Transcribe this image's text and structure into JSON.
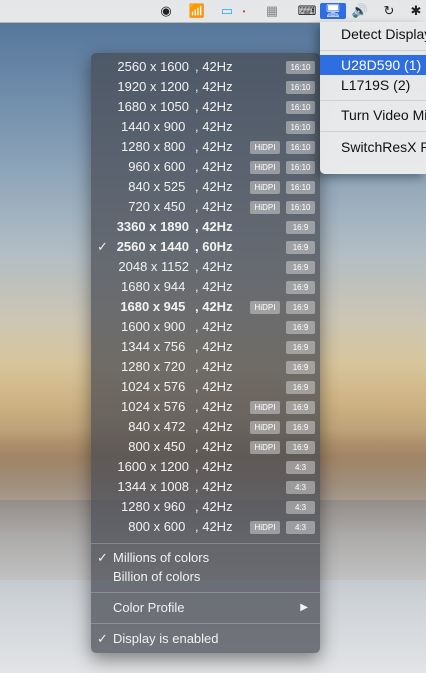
{
  "menubar": {
    "icons": [
      {
        "name": "switchresx-logo-icon",
        "glyph": "◉"
      },
      {
        "name": "wifi-icon",
        "glyph": "📶"
      },
      {
        "name": "battery-icon",
        "glyph": "▭"
      },
      {
        "name": "app-icon",
        "glyph": "▦"
      },
      {
        "name": "keyboard-icon",
        "glyph": "⌨"
      },
      {
        "name": "display-menu-icon",
        "glyph": "🖥"
      },
      {
        "name": "volume-icon",
        "glyph": "🔊"
      },
      {
        "name": "time-machine-icon",
        "glyph": "↻"
      },
      {
        "name": "bluetooth-icon",
        "glyph": "✱"
      }
    ]
  },
  "resolutions": [
    {
      "res": "2560 x 1600",
      "hz": ", 42Hz",
      "hidpi": false,
      "ratio": "16:10",
      "checked": false,
      "bold": false
    },
    {
      "res": "1920 x 1200",
      "hz": ", 42Hz",
      "hidpi": false,
      "ratio": "16:10",
      "checked": false,
      "bold": false
    },
    {
      "res": "1680 x 1050",
      "hz": ", 42Hz",
      "hidpi": false,
      "ratio": "16:10",
      "checked": false,
      "bold": false
    },
    {
      "res": "1440 x 900 ",
      "hz": ", 42Hz",
      "hidpi": false,
      "ratio": "16:10",
      "checked": false,
      "bold": false
    },
    {
      "res": "1280 x 800 ",
      "hz": ", 42Hz",
      "hidpi": true,
      "ratio": "16:10",
      "checked": false,
      "bold": false
    },
    {
      "res": "960 x 600 ",
      "hz": ", 42Hz",
      "hidpi": true,
      "ratio": "16:10",
      "checked": false,
      "bold": false
    },
    {
      "res": "840 x 525 ",
      "hz": ", 42Hz",
      "hidpi": true,
      "ratio": "16:10",
      "checked": false,
      "bold": false
    },
    {
      "res": "720 x 450 ",
      "hz": ", 42Hz",
      "hidpi": true,
      "ratio": "16:10",
      "checked": false,
      "bold": false
    },
    {
      "res": "3360 x 1890",
      "hz": ", 42Hz",
      "hidpi": false,
      "ratio": "16:9",
      "checked": false,
      "bold": true
    },
    {
      "res": "2560 x 1440",
      "hz": ", 60Hz",
      "hidpi": false,
      "ratio": "16:9",
      "checked": true,
      "bold": true
    },
    {
      "res": "2048 x 1152",
      "hz": ", 42Hz",
      "hidpi": false,
      "ratio": "16:9",
      "checked": false,
      "bold": false
    },
    {
      "res": "1680 x 944 ",
      "hz": ", 42Hz",
      "hidpi": false,
      "ratio": "16:9",
      "checked": false,
      "bold": false
    },
    {
      "res": "1680 x 945 ",
      "hz": ", 42Hz",
      "hidpi": true,
      "ratio": "16:9",
      "checked": false,
      "bold": true
    },
    {
      "res": "1600 x 900 ",
      "hz": ", 42Hz",
      "hidpi": false,
      "ratio": "16:9",
      "checked": false,
      "bold": false
    },
    {
      "res": "1344 x 756 ",
      "hz": ", 42Hz",
      "hidpi": false,
      "ratio": "16:9",
      "checked": false,
      "bold": false
    },
    {
      "res": "1280 x 720 ",
      "hz": ", 42Hz",
      "hidpi": false,
      "ratio": "16:9",
      "checked": false,
      "bold": false
    },
    {
      "res": "1024 x 576 ",
      "hz": ", 42Hz",
      "hidpi": false,
      "ratio": "16:9",
      "checked": false,
      "bold": false
    },
    {
      "res": "1024 x 576 ",
      "hz": ", 42Hz",
      "hidpi": true,
      "ratio": "16:9",
      "checked": false,
      "bold": false
    },
    {
      "res": "840 x 472 ",
      "hz": ", 42Hz",
      "hidpi": true,
      "ratio": "16:9",
      "checked": false,
      "bold": false
    },
    {
      "res": "800 x 450 ",
      "hz": ", 42Hz",
      "hidpi": true,
      "ratio": "16:9",
      "checked": false,
      "bold": false
    },
    {
      "res": "1600 x 1200",
      "hz": ", 42Hz",
      "hidpi": false,
      "ratio": "4:3",
      "checked": false,
      "bold": false
    },
    {
      "res": "1344 x 1008",
      "hz": ", 42Hz",
      "hidpi": false,
      "ratio": "4:3",
      "checked": false,
      "bold": false
    },
    {
      "res": "1280 x 960 ",
      "hz": ", 42Hz",
      "hidpi": false,
      "ratio": "4:3",
      "checked": false,
      "bold": false
    },
    {
      "res": "800 x 600 ",
      "hz": ", 42Hz",
      "hidpi": true,
      "ratio": "4:3",
      "checked": false,
      "bold": false
    }
  ],
  "hidpi_label": "HiDPI",
  "check_glyph": "✓",
  "options": {
    "millions": "Millions of colors",
    "billion": "Billion of colors",
    "color_profile": "Color Profile",
    "submenu_arrow": "▶",
    "display_enabled": "Display is enabled"
  },
  "display_menu": {
    "detect": "Detect Displays",
    "displays": [
      {
        "label": "U28D590 (1)",
        "selected": true
      },
      {
        "label": "L1719S (2)",
        "selected": false
      }
    ],
    "turn_video": "Turn Video Mirroring On",
    "switchresx": "SwitchResX Preferences..."
  }
}
